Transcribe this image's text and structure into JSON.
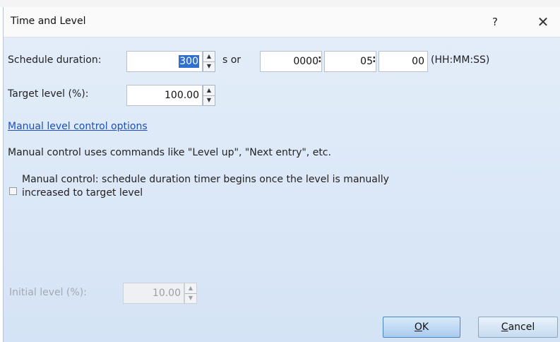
{
  "window": {
    "title": "Time and Level",
    "help_label": "?",
    "close_label": "✕"
  },
  "schedule": {
    "label": "Schedule duration:",
    "seconds_value": "300",
    "or_label": "s or",
    "hours": "0000",
    "minutes": "05",
    "seconds": "00",
    "separator": ":",
    "format_label": "(HH:MM:SS)"
  },
  "target": {
    "label": "Target level (%):",
    "value": "100.00"
  },
  "manual": {
    "options_link": "Manual level control options",
    "description": "Manual control uses commands like \"Level up\", \"Next entry\", etc.",
    "checkbox_label": "Manual control: schedule duration timer begins once the level is manually increased to target level",
    "checkbox_checked": false
  },
  "initial": {
    "label": "Initial level (%):",
    "value": "10.00"
  },
  "buttons": {
    "ok_mnemonic": "O",
    "ok_rest": "K",
    "cancel_mnemonic": "C",
    "cancel_rest": "ancel"
  },
  "icons": {
    "spin_up": "▲",
    "spin_down": "▼"
  }
}
